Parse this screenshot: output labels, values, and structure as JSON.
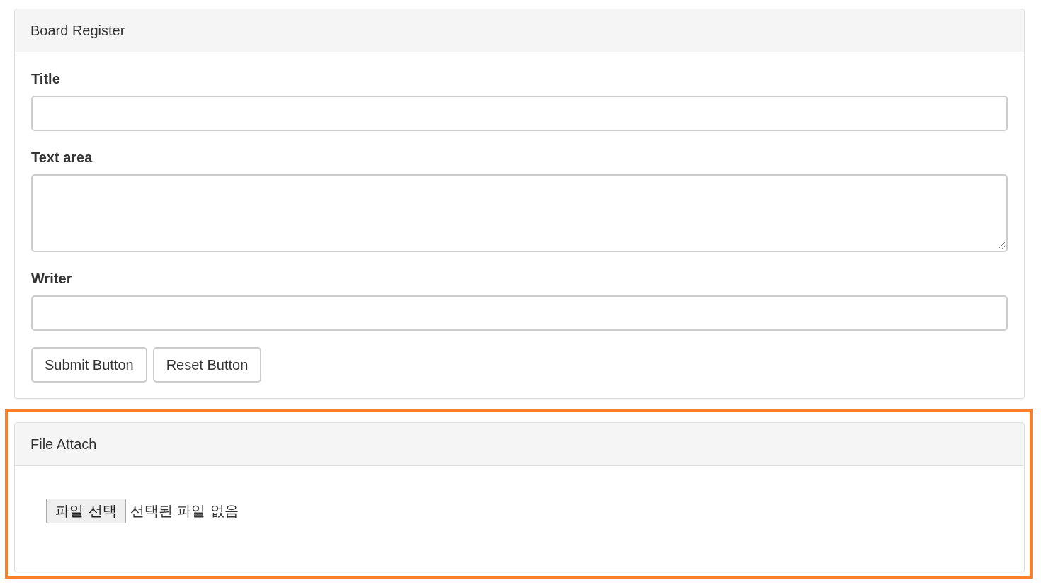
{
  "panels": [
    {
      "kind": "form",
      "heading": "Board Register",
      "highlighted": false,
      "fields": [
        {
          "kind": "input",
          "label": "Title"
        },
        {
          "kind": "textarea",
          "label": "Text area"
        },
        {
          "kind": "input",
          "label": "Writer"
        }
      ],
      "buttons": [
        "Submit Button",
        "Reset Button"
      ]
    },
    {
      "kind": "file",
      "heading": "File Attach",
      "highlighted": true,
      "file_input": {
        "button": "파일 선택",
        "status": "선택된 파일 없음"
      }
    }
  ]
}
